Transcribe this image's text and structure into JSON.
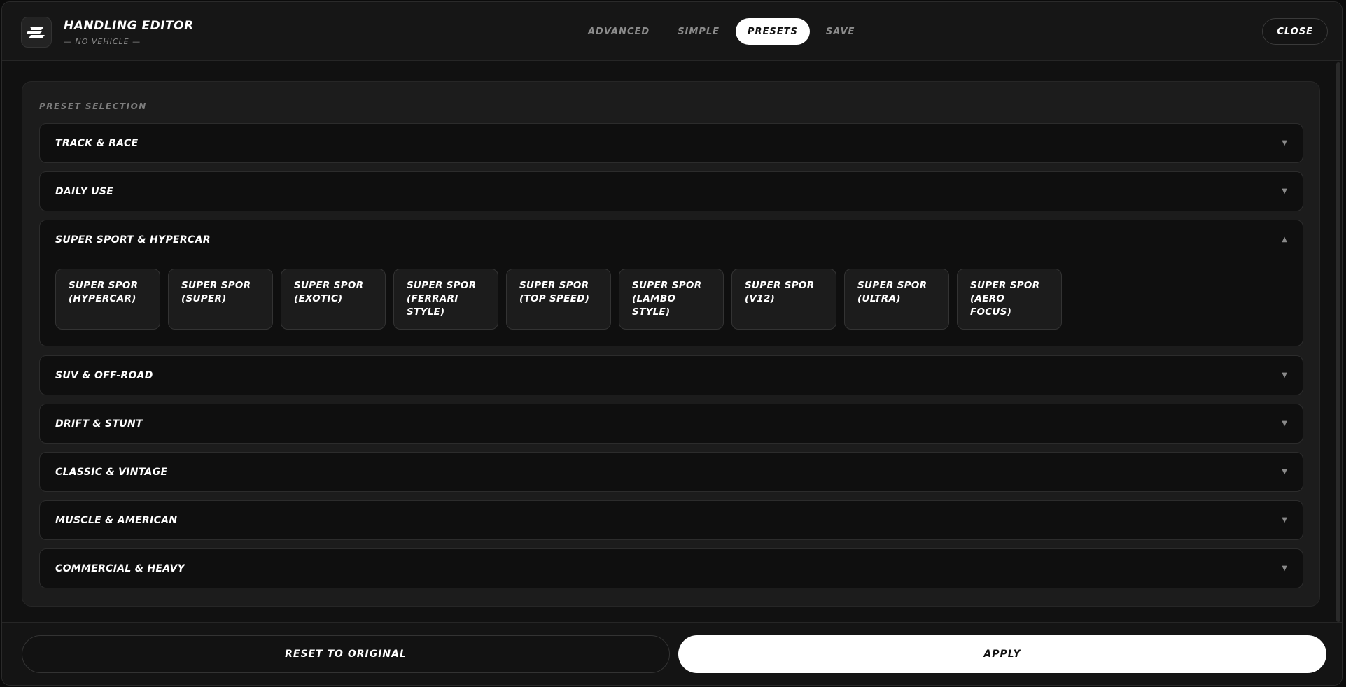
{
  "app": {
    "title": "HANDLING EDITOR",
    "subtitle": "— NO VEHICLE —"
  },
  "tabs": [
    {
      "label": "ADVANCED",
      "active": false
    },
    {
      "label": "SIMPLE",
      "active": false
    },
    {
      "label": "PRESETS",
      "active": true
    },
    {
      "label": "SAVE",
      "active": false
    }
  ],
  "close_label": "CLOSE",
  "section_label": "PRESET SELECTION",
  "categories": [
    {
      "label": "TRACK & RACE",
      "expanded": false
    },
    {
      "label": "DAILY USE",
      "expanded": false
    },
    {
      "label": "SUPER SPORT & HYPERCAR",
      "expanded": true,
      "presets": [
        [
          "SUPER SPOR",
          "(HYPERCAR)"
        ],
        [
          "SUPER SPOR",
          "(SUPER)"
        ],
        [
          "SUPER SPOR",
          "(EXOTIC)"
        ],
        [
          "SUPER SPOR",
          "(FERRARI",
          "STYLE)"
        ],
        [
          "SUPER SPOR",
          "(TOP SPEED)"
        ],
        [
          "SUPER SPOR",
          "(LAMBO",
          "STYLE)"
        ],
        [
          "SUPER SPOR",
          "(V12)"
        ],
        [
          "SUPER SPOR",
          "(ULTRA)"
        ],
        [
          "SUPER SPOR",
          "(AERO FOCUS)"
        ]
      ]
    },
    {
      "label": "SUV & OFF-ROAD",
      "expanded": false
    },
    {
      "label": "DRIFT & STUNT",
      "expanded": false
    },
    {
      "label": "CLASSIC & VINTAGE",
      "expanded": false
    },
    {
      "label": "MUSCLE & AMERICAN",
      "expanded": false
    },
    {
      "label": "COMMERCIAL & HEAVY",
      "expanded": false
    }
  ],
  "icons": {
    "collapsed": "chevron-down-icon",
    "expanded": "chevron-up-icon",
    "logo": "logo-icon"
  },
  "footer": {
    "reset_label": "RESET TO ORIGINAL",
    "apply_label": "APPLY"
  }
}
